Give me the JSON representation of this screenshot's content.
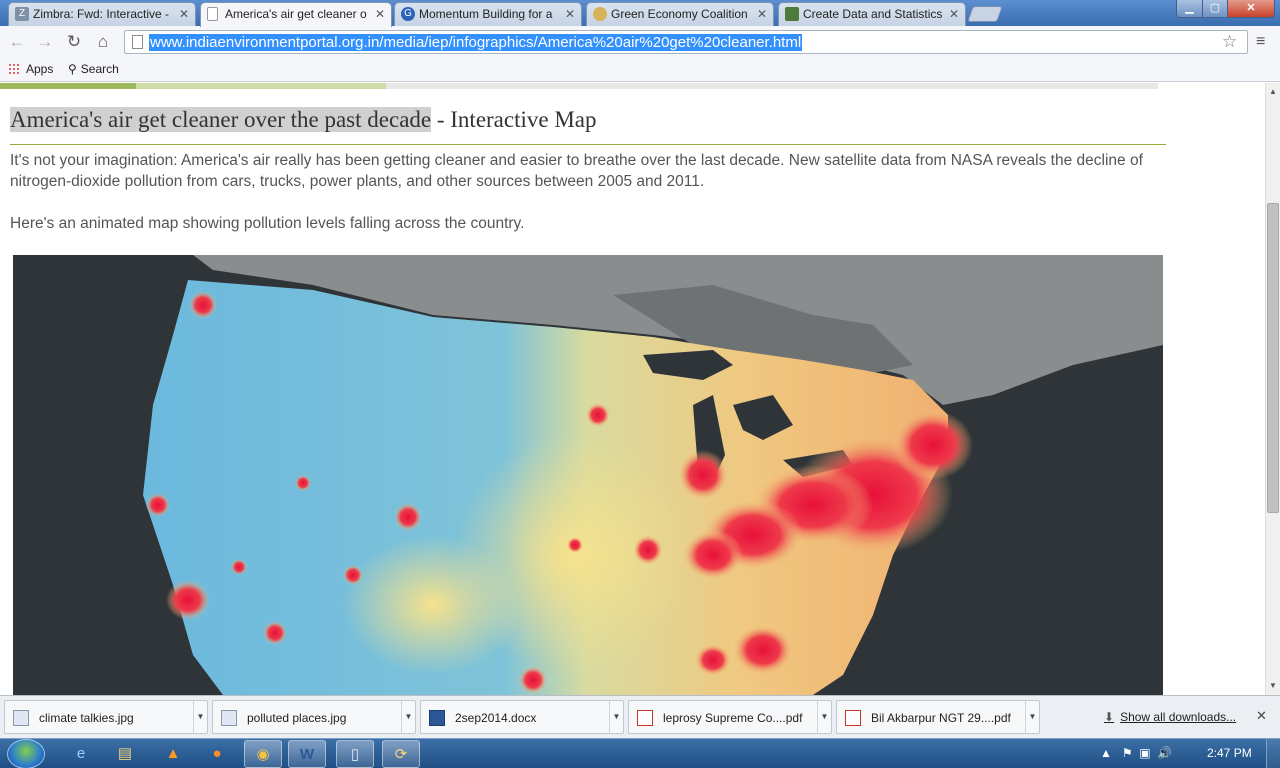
{
  "tabs": [
    {
      "title": "Zimbra: Fwd: Interactive -",
      "favicon": "zimbra-icon",
      "active": false
    },
    {
      "title": "America's air get cleaner o",
      "favicon": "page-icon",
      "active": true
    },
    {
      "title": "Momentum Building for a",
      "favicon": "globe-icon",
      "active": false
    },
    {
      "title": "Green Economy Coalition",
      "favicon": "gec-icon",
      "active": false
    },
    {
      "title": "Create Data and Statistics",
      "favicon": "data-icon",
      "active": false
    }
  ],
  "toolbar": {
    "back": "←",
    "forward": "→",
    "reload": "↻",
    "home": "⌂",
    "url": "www.indiaenvironmentportal.org.in/media/iep/infographics/America%20air%20get%20cleaner.html"
  },
  "bookmarks": {
    "apps": "Apps",
    "search": "Search"
  },
  "page": {
    "title_highlighted": "America's air get cleaner over the past decade",
    "title_rest": " - Interactive Map",
    "para1": "It's not your imagination: America's air really has been getting cleaner and easier to breathe over the last decade. New satellite data from NASA reveals the decline of nitrogen-dioxide pollution from cars, trucks, power plants, and other sources between 2005 and 2011.",
    "para2": "Here's an animated map showing pollution levels falling across the country."
  },
  "downloads": {
    "items": [
      {
        "name": "climate talkies.jpg",
        "type": "image"
      },
      {
        "name": "polluted places.jpg",
        "type": "image"
      },
      {
        "name": "2sep2014.docx",
        "type": "doc"
      },
      {
        "name": "leprosy Supreme Co....pdf",
        "type": "pdf"
      },
      {
        "name": "Bil Akbarpur NGT 29....pdf",
        "type": "pdf"
      }
    ],
    "show_all": "Show all downloads..."
  },
  "taskbar": {
    "clock": "2:47 PM"
  },
  "colors": {
    "pollution_high": "#e8103a",
    "pollution_mid": "#f3e08a",
    "pollution_low": "#6fb8dc",
    "ocean": "#2e3438",
    "accent_rule": "#8fae3a"
  }
}
